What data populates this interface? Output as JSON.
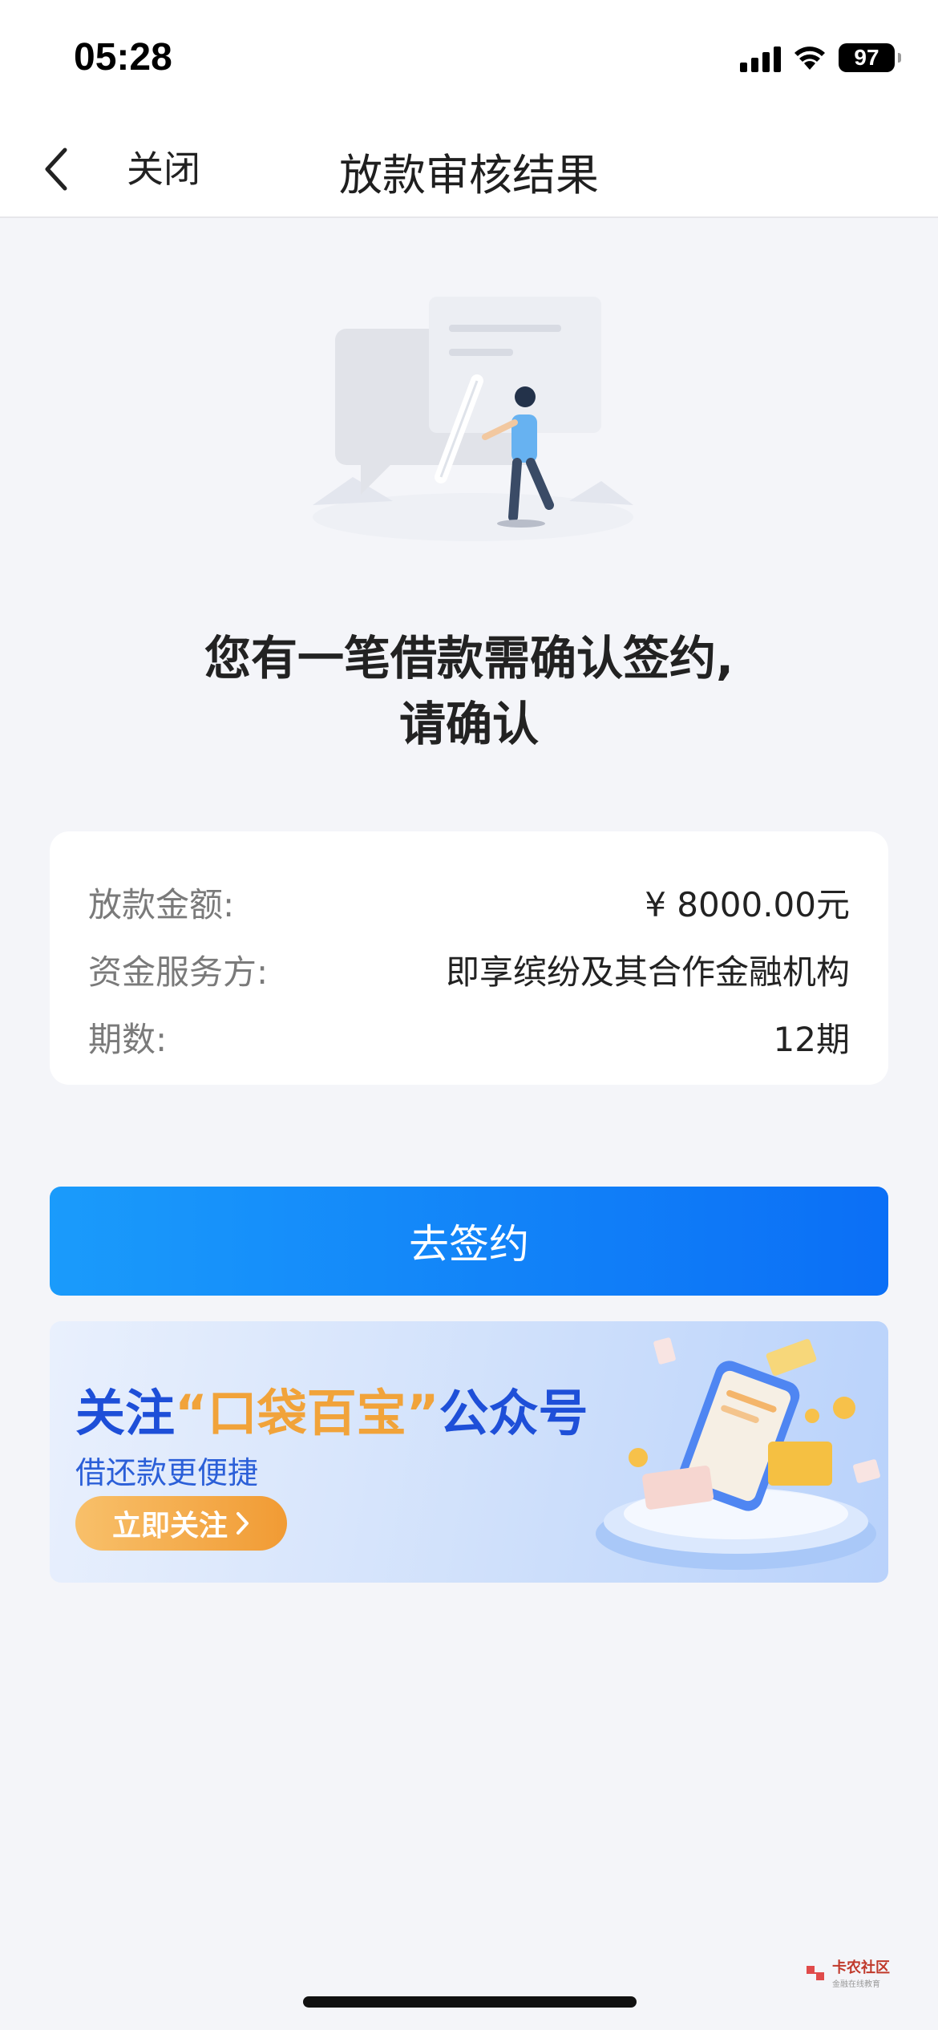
{
  "status_bar": {
    "time": "05:28",
    "battery": "97"
  },
  "navbar": {
    "close_label": "关闭",
    "title": "放款审核结果"
  },
  "headline": {
    "line1": "您有一笔借款需确认签约,",
    "line2": "请确认"
  },
  "loan_info": [
    {
      "label": "放款金额:",
      "value": "¥ 8000.00元"
    },
    {
      "label": "资金服务方:",
      "value": "即享缤纷及其合作金融机构"
    },
    {
      "label": "期数:",
      "value": "12期"
    }
  ],
  "primary_button": {
    "label": "去签约"
  },
  "banner": {
    "title_prefix": "关注",
    "title_highlight": "“口袋百宝”",
    "title_suffix": "公众号",
    "subtitle": "借还款更便捷",
    "button_label": "立即关注",
    "button_icon": "chevron-right-icon"
  },
  "watermark": {
    "text": "卡农社区",
    "subtext": "金融在线教育"
  },
  "colors": {
    "primary": "#0b6ff6",
    "primary_light": "#1a9bfb",
    "banner_title": "#1e4fd8",
    "banner_highlight": "#f1a33a",
    "banner_button": "#f19b34"
  }
}
